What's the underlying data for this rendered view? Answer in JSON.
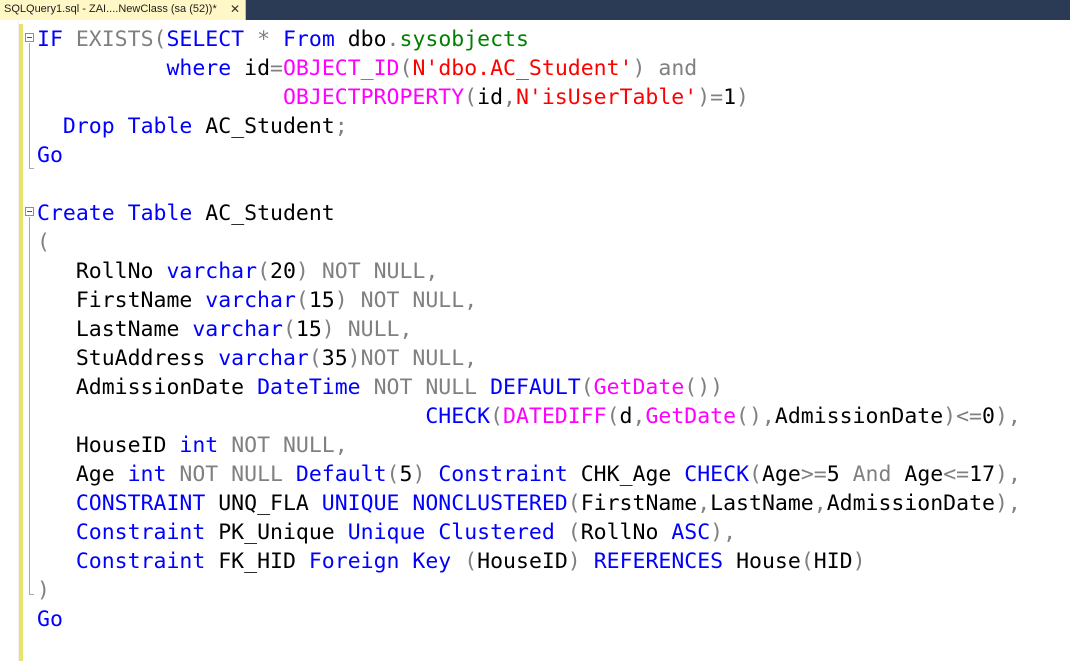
{
  "tab": {
    "title": "SQLQuery1.sql - ZAI....NewClass (sa (52))*",
    "close_glyph": "✕"
  },
  "colors": {
    "keyword": "#0000ff",
    "operator": "#808080",
    "string": "#ff0000",
    "function": "#ff00ff",
    "system_object": "#008000",
    "change_bar": "#e8e36a",
    "tab_active": "#fff7c6"
  },
  "editor": {
    "lines": [
      [
        {
          "c": "kw",
          "t": "IF"
        },
        {
          "c": "tx",
          "t": " "
        },
        {
          "c": "gr",
          "t": "EXISTS("
        },
        {
          "c": "kw",
          "t": "SELECT"
        },
        {
          "c": "tx",
          "t": " "
        },
        {
          "c": "gr",
          "t": "*"
        },
        {
          "c": "tx",
          "t": " "
        },
        {
          "c": "kw",
          "t": "From"
        },
        {
          "c": "tx",
          "t": " dbo"
        },
        {
          "c": "gr",
          "t": "."
        },
        {
          "c": "grn",
          "t": "sysobjects"
        }
      ],
      [
        {
          "c": "tx",
          "t": "          "
        },
        {
          "c": "kw",
          "t": "where"
        },
        {
          "c": "tx",
          "t": " id"
        },
        {
          "c": "gr",
          "t": "="
        },
        {
          "c": "fn",
          "t": "OBJECT_ID"
        },
        {
          "c": "gr",
          "t": "("
        },
        {
          "c": "str",
          "t": "N'dbo.AC_Student'"
        },
        {
          "c": "gr",
          "t": ")"
        },
        {
          "c": "tx",
          "t": " "
        },
        {
          "c": "gr",
          "t": "and"
        }
      ],
      [
        {
          "c": "tx",
          "t": "                   "
        },
        {
          "c": "fn",
          "t": "OBJECTPROPERTY"
        },
        {
          "c": "gr",
          "t": "("
        },
        {
          "c": "tx",
          "t": "id"
        },
        {
          "c": "gr",
          "t": ","
        },
        {
          "c": "str",
          "t": "N'isUserTable'"
        },
        {
          "c": "gr",
          "t": ")="
        },
        {
          "c": "tx",
          "t": "1"
        },
        {
          "c": "gr",
          "t": ")"
        }
      ],
      [
        {
          "c": "tx",
          "t": "  "
        },
        {
          "c": "kw",
          "t": "Drop"
        },
        {
          "c": "tx",
          "t": " "
        },
        {
          "c": "kw",
          "t": "Table"
        },
        {
          "c": "tx",
          "t": " AC_Student"
        },
        {
          "c": "gr",
          "t": ";"
        }
      ],
      [
        {
          "c": "kw",
          "t": "Go"
        }
      ],
      [
        {
          "c": "tx",
          "t": ""
        }
      ],
      [
        {
          "c": "kw",
          "t": "Create"
        },
        {
          "c": "tx",
          "t": " "
        },
        {
          "c": "kw",
          "t": "Table"
        },
        {
          "c": "tx",
          "t": " AC_Student"
        }
      ],
      [
        {
          "c": "gr",
          "t": "("
        }
      ],
      [
        {
          "c": "tx",
          "t": "   RollNo "
        },
        {
          "c": "kw",
          "t": "varchar"
        },
        {
          "c": "gr",
          "t": "("
        },
        {
          "c": "tx",
          "t": "20"
        },
        {
          "c": "gr",
          "t": ")"
        },
        {
          "c": "tx",
          "t": " "
        },
        {
          "c": "gr",
          "t": "NOT NULL,"
        }
      ],
      [
        {
          "c": "tx",
          "t": "   FirstName "
        },
        {
          "c": "kw",
          "t": "varchar"
        },
        {
          "c": "gr",
          "t": "("
        },
        {
          "c": "tx",
          "t": "15"
        },
        {
          "c": "gr",
          "t": ")"
        },
        {
          "c": "tx",
          "t": " "
        },
        {
          "c": "gr",
          "t": "NOT NULL,"
        }
      ],
      [
        {
          "c": "tx",
          "t": "   LastName "
        },
        {
          "c": "kw",
          "t": "varchar"
        },
        {
          "c": "gr",
          "t": "("
        },
        {
          "c": "tx",
          "t": "15"
        },
        {
          "c": "gr",
          "t": ")"
        },
        {
          "c": "tx",
          "t": " "
        },
        {
          "c": "gr",
          "t": "NULL,"
        }
      ],
      [
        {
          "c": "tx",
          "t": "   StuAddress "
        },
        {
          "c": "kw",
          "t": "varchar"
        },
        {
          "c": "gr",
          "t": "("
        },
        {
          "c": "tx",
          "t": "35"
        },
        {
          "c": "gr",
          "t": ")NOT NULL,"
        }
      ],
      [
        {
          "c": "tx",
          "t": "   AdmissionDate "
        },
        {
          "c": "kw",
          "t": "DateTime"
        },
        {
          "c": "tx",
          "t": " "
        },
        {
          "c": "gr",
          "t": "NOT NULL"
        },
        {
          "c": "tx",
          "t": " "
        },
        {
          "c": "kw",
          "t": "DEFAULT"
        },
        {
          "c": "gr",
          "t": "("
        },
        {
          "c": "fn",
          "t": "GetDate"
        },
        {
          "c": "gr",
          "t": "())"
        }
      ],
      [
        {
          "c": "tx",
          "t": "                              "
        },
        {
          "c": "kw",
          "t": "CHECK"
        },
        {
          "c": "gr",
          "t": "("
        },
        {
          "c": "fn",
          "t": "DATEDIFF"
        },
        {
          "c": "gr",
          "t": "("
        },
        {
          "c": "tx",
          "t": "d"
        },
        {
          "c": "gr",
          "t": ","
        },
        {
          "c": "fn",
          "t": "GetDate"
        },
        {
          "c": "gr",
          "t": "(),"
        },
        {
          "c": "tx",
          "t": "AdmissionDate"
        },
        {
          "c": "gr",
          "t": ")<="
        },
        {
          "c": "tx",
          "t": "0"
        },
        {
          "c": "gr",
          "t": "),"
        }
      ],
      [
        {
          "c": "tx",
          "t": "   HouseID "
        },
        {
          "c": "kw",
          "t": "int"
        },
        {
          "c": "tx",
          "t": " "
        },
        {
          "c": "gr",
          "t": "NOT NULL,"
        }
      ],
      [
        {
          "c": "tx",
          "t": "   Age "
        },
        {
          "c": "kw",
          "t": "int"
        },
        {
          "c": "tx",
          "t": " "
        },
        {
          "c": "gr",
          "t": "NOT NULL"
        },
        {
          "c": "tx",
          "t": " "
        },
        {
          "c": "kw",
          "t": "Default"
        },
        {
          "c": "gr",
          "t": "("
        },
        {
          "c": "tx",
          "t": "5"
        },
        {
          "c": "gr",
          "t": ")"
        },
        {
          "c": "tx",
          "t": " "
        },
        {
          "c": "kw",
          "t": "Constraint"
        },
        {
          "c": "tx",
          "t": " CHK_Age "
        },
        {
          "c": "kw",
          "t": "CHECK"
        },
        {
          "c": "gr",
          "t": "("
        },
        {
          "c": "tx",
          "t": "Age"
        },
        {
          "c": "gr",
          "t": ">="
        },
        {
          "c": "tx",
          "t": "5 "
        },
        {
          "c": "gr",
          "t": "And"
        },
        {
          "c": "tx",
          "t": " Age"
        },
        {
          "c": "gr",
          "t": "<="
        },
        {
          "c": "tx",
          "t": "17"
        },
        {
          "c": "gr",
          "t": "),"
        }
      ],
      [
        {
          "c": "tx",
          "t": "   "
        },
        {
          "c": "kw",
          "t": "CONSTRAINT"
        },
        {
          "c": "tx",
          "t": " UNQ_FLA "
        },
        {
          "c": "kw",
          "t": "UNIQUE"
        },
        {
          "c": "tx",
          "t": " "
        },
        {
          "c": "kw",
          "t": "NONCLUSTERED"
        },
        {
          "c": "gr",
          "t": "("
        },
        {
          "c": "tx",
          "t": "FirstName"
        },
        {
          "c": "gr",
          "t": ","
        },
        {
          "c": "tx",
          "t": "LastName"
        },
        {
          "c": "gr",
          "t": ","
        },
        {
          "c": "tx",
          "t": "AdmissionDate"
        },
        {
          "c": "gr",
          "t": "),"
        }
      ],
      [
        {
          "c": "tx",
          "t": "   "
        },
        {
          "c": "kw",
          "t": "Constraint"
        },
        {
          "c": "tx",
          "t": " PK_Unique "
        },
        {
          "c": "kw",
          "t": "Unique"
        },
        {
          "c": "tx",
          "t": " "
        },
        {
          "c": "kw",
          "t": "Clustered"
        },
        {
          "c": "tx",
          "t": " "
        },
        {
          "c": "gr",
          "t": "("
        },
        {
          "c": "tx",
          "t": "RollNo "
        },
        {
          "c": "kw",
          "t": "ASC"
        },
        {
          "c": "gr",
          "t": "),"
        }
      ],
      [
        {
          "c": "tx",
          "t": "   "
        },
        {
          "c": "kw",
          "t": "Constraint"
        },
        {
          "c": "tx",
          "t": " FK_HID "
        },
        {
          "c": "kw",
          "t": "Foreign"
        },
        {
          "c": "tx",
          "t": " "
        },
        {
          "c": "kw",
          "t": "Key"
        },
        {
          "c": "tx",
          "t": " "
        },
        {
          "c": "gr",
          "t": "("
        },
        {
          "c": "tx",
          "t": "HouseID"
        },
        {
          "c": "gr",
          "t": ")"
        },
        {
          "c": "tx",
          "t": " "
        },
        {
          "c": "kw",
          "t": "REFERENCES"
        },
        {
          "c": "tx",
          "t": " House"
        },
        {
          "c": "gr",
          "t": "("
        },
        {
          "c": "tx",
          "t": "HID"
        },
        {
          "c": "gr",
          "t": ")"
        }
      ],
      [
        {
          "c": "gr",
          "t": ")"
        }
      ],
      [
        {
          "c": "kw",
          "t": "Go"
        }
      ]
    ]
  }
}
